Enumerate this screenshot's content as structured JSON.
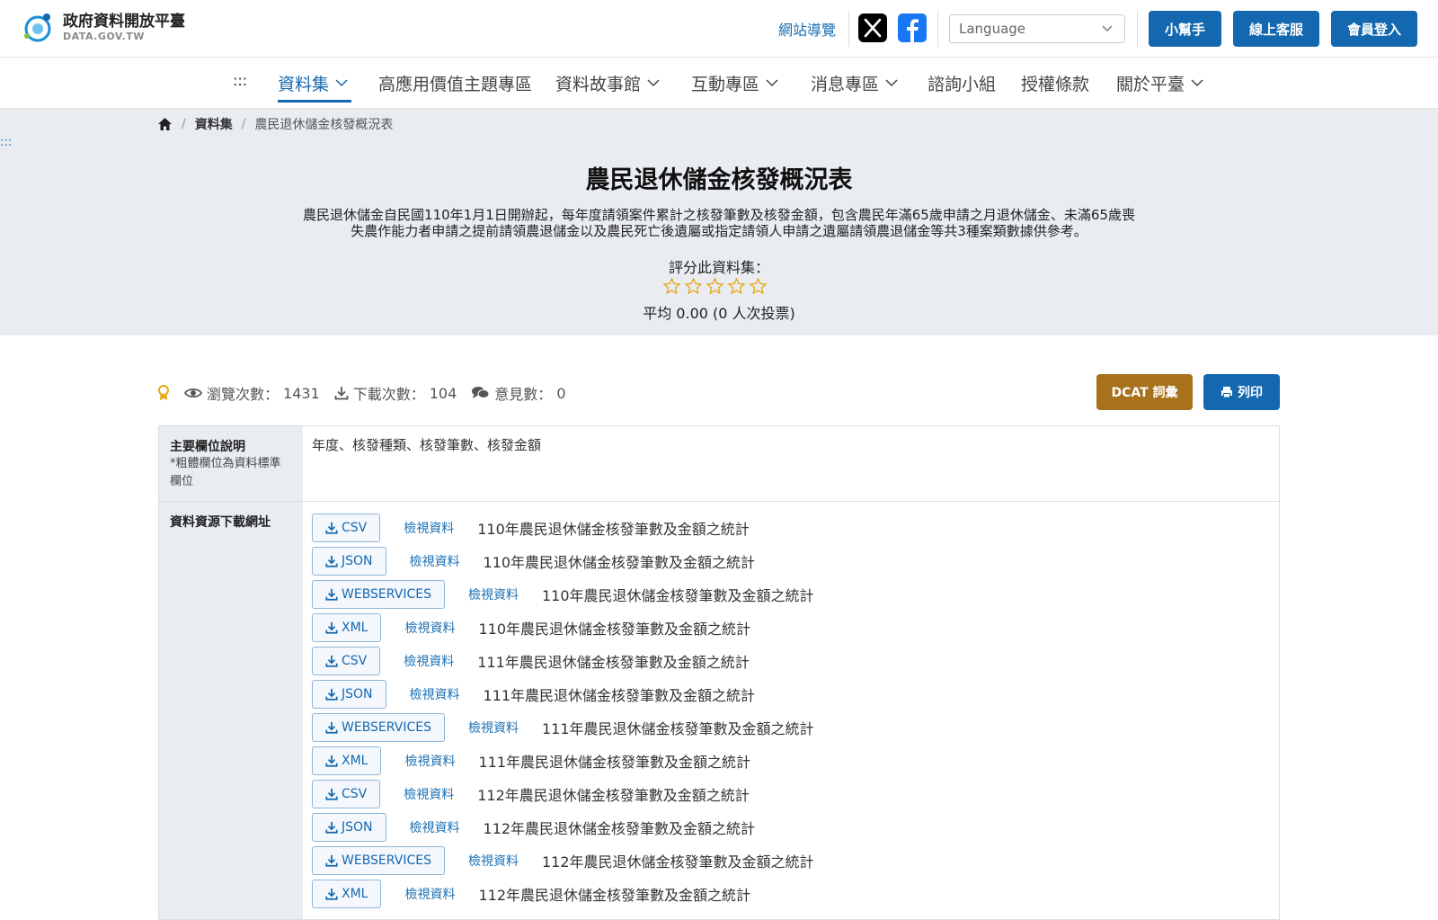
{
  "header": {
    "logo_title": "政府資料開放平臺",
    "logo_sub": "DATA.GOV.TW",
    "sitemap": "網站導覽",
    "language_placeholder": "Language",
    "btn_helper": "小幫手",
    "btn_service": "線上客服",
    "btn_login": "會員登入"
  },
  "nav": {
    "accesskey": ":::",
    "items": [
      "資料集",
      "高應用價值主題專區",
      "資料故事館",
      "互動專區",
      "消息專區",
      "諮詢小組",
      "授權條款",
      "關於平臺"
    ]
  },
  "breadcrumb": {
    "level1": "資料集",
    "current": "農民退休儲金核發概況表"
  },
  "hero": {
    "accesskey": ":::",
    "title": "農民退休儲金核發概況表",
    "description": "農民退休儲金自民國110年1月1日開辦起，每年度請領案件累計之核發筆數及核發金額，包含農民年滿65歲申請之月退休儲金、未滿65歲喪失農作能力者申請之提前請領農退儲金以及農民死亡後遺屬或指定請領人申請之遺屬請領農退儲金等共3種案類數據供參考。",
    "rate_label": "評分此資料集：",
    "average": "平均 0.00 (0 人次投票)",
    "star_count": 5,
    "star_color": "#e6a817"
  },
  "stats": {
    "views_label": "瀏覽次數：",
    "views": "1431",
    "downloads_label": "下載次數：",
    "downloads": "104",
    "comments_label": "意見數：",
    "comments": "0",
    "btn_dcat": "DCAT 詞彙",
    "btn_print": "列印"
  },
  "table": {
    "fields_header": "主要欄位說明",
    "fields_note": "*粗體欄位為資料標準欄位",
    "fields_value": "年度、核發種類、核發筆數、核發金額",
    "resources_header": "資料資源下載網址",
    "view_label": "檢視資料",
    "resources": [
      {
        "format": "CSV",
        "name": "110年農民退休儲金核發筆數及金額之統計"
      },
      {
        "format": "JSON",
        "name": "110年農民退休儲金核發筆數及金額之統計"
      },
      {
        "format": "WEBSERVICES",
        "name": "110年農民退休儲金核發筆數及金額之統計"
      },
      {
        "format": "XML",
        "name": "110年農民退休儲金核發筆數及金額之統計"
      },
      {
        "format": "CSV",
        "name": "111年農民退休儲金核發筆數及金額之統計"
      },
      {
        "format": "JSON",
        "name": "111年農民退休儲金核發筆數及金額之統計"
      },
      {
        "format": "WEBSERVICES",
        "name": "111年農民退休儲金核發筆數及金額之統計"
      },
      {
        "format": "XML",
        "name": "111年農民退休儲金核發筆數及金額之統計"
      },
      {
        "format": "CSV",
        "name": "112年農民退休儲金核發筆數及金額之統計"
      },
      {
        "format": "JSON",
        "name": "112年農民退休儲金核發筆數及金額之統計"
      },
      {
        "format": "WEBSERVICES",
        "name": "112年農民退休儲金核發筆數及金額之統計"
      },
      {
        "format": "XML",
        "name": "112年農民退休儲金核發筆數及金額之統計"
      }
    ]
  }
}
